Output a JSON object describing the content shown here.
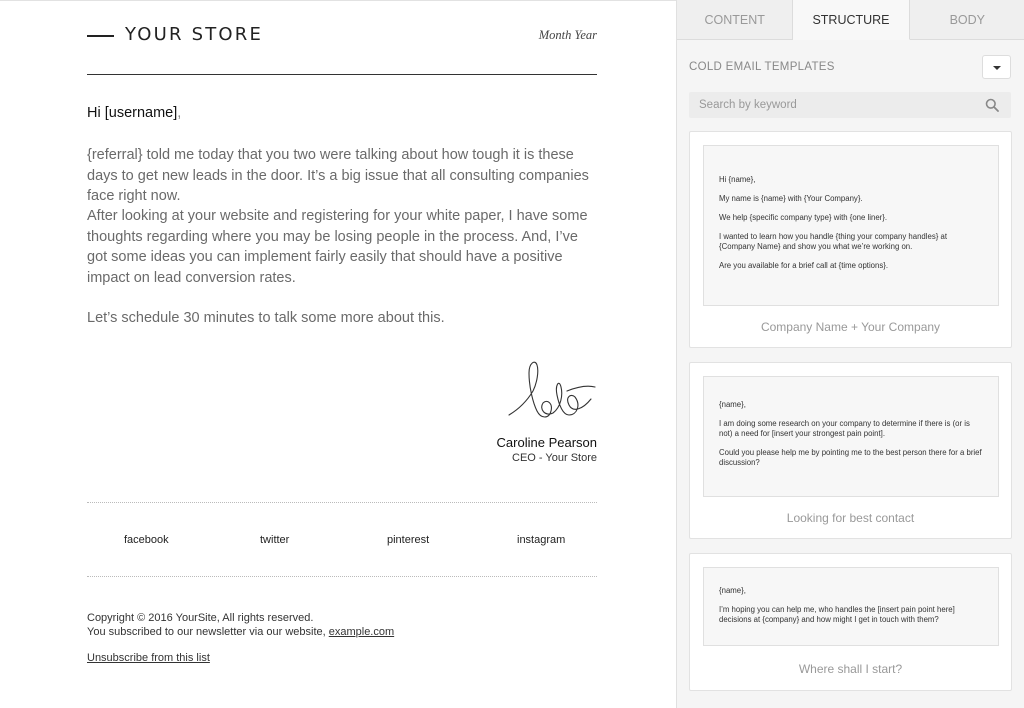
{
  "email": {
    "brand": "YOUR STORE",
    "date": "Month Year",
    "greeting_name": "Hi [username]",
    "greeting_comma": ",",
    "paragraphs": [
      "{referral} told me today that you two were talking about how tough it is these days to get new leads in the door. It’s a big issue that all consulting companies face right now.",
      "After looking at your website and registering for your white paper, I have some thoughts regarding where you may be losing people in the process. And, I’ve got some ideas you can implement fairly easily that should have a positive impact on lead conversion rates.",
      "Let’s schedule 30 minutes to talk some more about this."
    ],
    "signer_name": "Caroline Pearson",
    "signer_role": "CEO - Your Store",
    "social": [
      "facebook",
      "twitter",
      "pinterest",
      "instagram"
    ],
    "copyright": "Copyright © 2016 YourSite, All rights reserved.",
    "subscribed_text": "You subscribed to our newsletter via our website,",
    "website_link": "example.com",
    "unsubscribe": "Unsubscribe from this list"
  },
  "panel": {
    "tabs": [
      {
        "label": "CONTENT",
        "active": false
      },
      {
        "label": "STRUCTURE",
        "active": true
      },
      {
        "label": "BODY",
        "active": false
      }
    ],
    "section_title": "COLD EMAIL TEMPLATES",
    "search_placeholder": "Search by keyword",
    "templates": [
      {
        "label": "Company Name + Your Company",
        "lines": [
          "Hi {name},",
          "My name is {name} with {Your Company}.",
          "We help {specific company type} with {one liner}.",
          "I wanted to learn how you handle {thing your company handles} at {Company Name} and show you what we’re working on.",
          "Are you available for a brief call at {time options}."
        ]
      },
      {
        "label": "Looking for best contact",
        "lines": [
          "{name},",
          "I am doing some research on your company to determine if there is (or is not) a need for [insert your strongest pain point].",
          "Could you please help me by pointing me to the best person there for a brief discussion?"
        ]
      },
      {
        "label": "Where shall I start?",
        "lines": [
          "{name},",
          "I’m hoping you can help me, who handles the [insert pain point here] decisions at {company} and how might I get in touch with them?"
        ]
      }
    ]
  }
}
